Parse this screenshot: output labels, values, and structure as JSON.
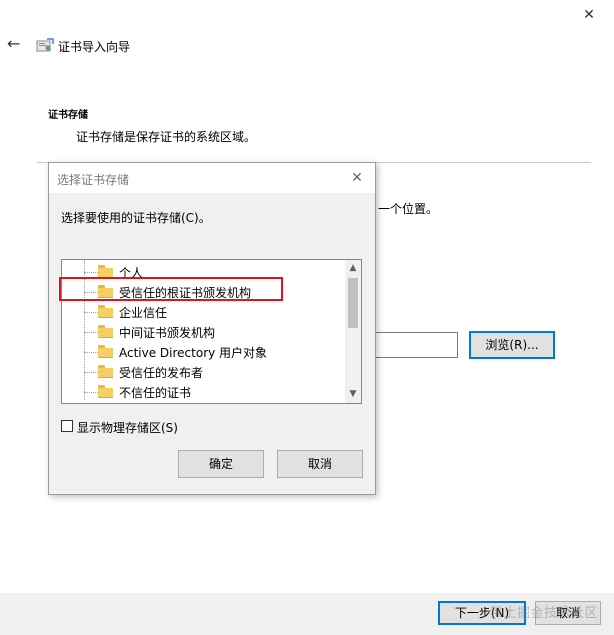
{
  "window": {
    "title": "证书导入向导",
    "close_glyph": "✕",
    "back_glyph": "←"
  },
  "page": {
    "section_title": "证书存储",
    "section_desc": "证书存储是保存证书的系统区域。",
    "partial_text": "一个位置。",
    "browse_label": "浏览(R)..."
  },
  "footer": {
    "next_label": "下一步(N)",
    "cancel_label": "取消",
    "watermark": "稀土掘金技术社区"
  },
  "dialog": {
    "title": "选择证书存储",
    "close_glyph": "✕",
    "label": "选择要使用的证书存储(C)。",
    "stores": [
      "个人",
      "受信任的根证书颁发机构",
      "企业信任",
      "中间证书颁发机构",
      "Active Directory 用户对象",
      "受信任的发布者",
      "不信任的证书"
    ],
    "selected_index": 1,
    "show_physical_label": "显示物理存储区(S)",
    "show_physical_checked": false,
    "ok_label": "确定",
    "cancel_label": "取消",
    "scroll_up": "▲",
    "scroll_down": "▼"
  },
  "colors": {
    "accent": "#0078d7",
    "highlight": "#e0141e",
    "folder": "#f5cf63"
  }
}
